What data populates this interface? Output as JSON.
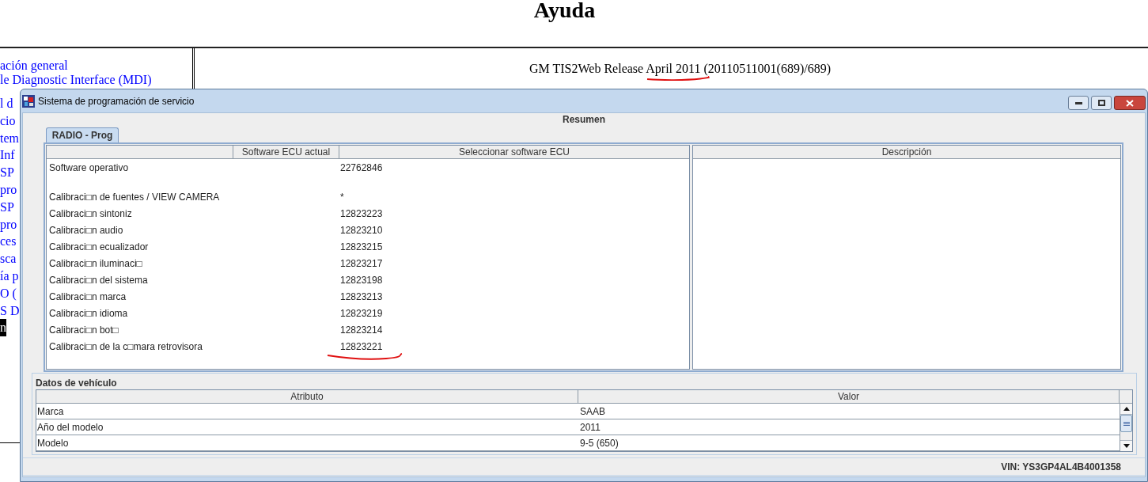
{
  "page": {
    "title": "Ayuda",
    "nav_links": [
      {
        "text": "ación general",
        "selected": false
      },
      {
        "text": "le Diagnostic Interface (MDI)",
        "selected": false
      },
      {
        "text": "l d",
        "selected": false
      },
      {
        "text": "cio",
        "selected": false
      },
      {
        "text": "tem",
        "selected": false
      },
      {
        "text": "Inf",
        "selected": false
      },
      {
        "text": "SP",
        "selected": false
      },
      {
        "text": "pro",
        "selected": false
      },
      {
        "text": "SP",
        "selected": false
      },
      {
        "text": "pro",
        "selected": false
      },
      {
        "text": "ces",
        "selected": false
      },
      {
        "text": "sca",
        "selected": false
      },
      {
        "text": "ía p",
        "selected": false
      },
      {
        "text": "O (",
        "selected": false
      },
      {
        "text": "S D",
        "selected": false
      },
      {
        "text": "n",
        "selected": true
      }
    ],
    "release": "GM TIS2Web Release April 2011 (20110511001(689)/689)"
  },
  "window": {
    "title": "Sistema de programación de servicio",
    "heading": "Resumen",
    "tabs": [
      {
        "label": "RADIO - Prog",
        "selected": true
      }
    ],
    "software_table": {
      "columns": [
        "Software ECU actual",
        "Seleccionar software ECU"
      ],
      "rows": [
        {
          "kind": "entry",
          "name": "Software operativo",
          "value": "22762846"
        },
        {
          "kind": "blank"
        },
        {
          "kind": "entry",
          "name": "Calibraci□n de fuentes / VIEW CAMERA",
          "value": "*"
        },
        {
          "kind": "entry",
          "name": "Calibraci□n sintoniz",
          "value": "12823223"
        },
        {
          "kind": "entry",
          "name": "Calibraci□n audio",
          "value": "12823210"
        },
        {
          "kind": "entry",
          "name": "Calibraci□n ecualizador",
          "value": "12823215"
        },
        {
          "kind": "entry",
          "name": "Calibraci□n iluminaci□",
          "value": "12823217"
        },
        {
          "kind": "entry",
          "name": "Calibraci□n del sistema",
          "value": "12823198"
        },
        {
          "kind": "entry",
          "name": "Calibraci□n marca",
          "value": "12823213"
        },
        {
          "kind": "entry",
          "name": "Calibraci□n idioma",
          "value": "12823219"
        },
        {
          "kind": "entry",
          "name": "Calibraci□n bot□",
          "value": "12823214"
        },
        {
          "kind": "entry",
          "name": "Calibraci□n de la c□mara retrovisora",
          "value": "12823221"
        }
      ]
    },
    "description_table": {
      "columns": [
        "Descripción"
      ]
    },
    "vehicle_data": {
      "title": "Datos de vehículo",
      "columns": [
        "Atributo",
        "Valor"
      ],
      "rows": [
        {
          "attribute": "Marca",
          "value": "SAAB"
        },
        {
          "attribute": "Año del modelo",
          "value": "2011"
        },
        {
          "attribute": "Modelo",
          "value": "9-5 (650)"
        }
      ]
    },
    "status_bar": {
      "vin": "VIN: YS3GP4AL4B4001358"
    }
  }
}
